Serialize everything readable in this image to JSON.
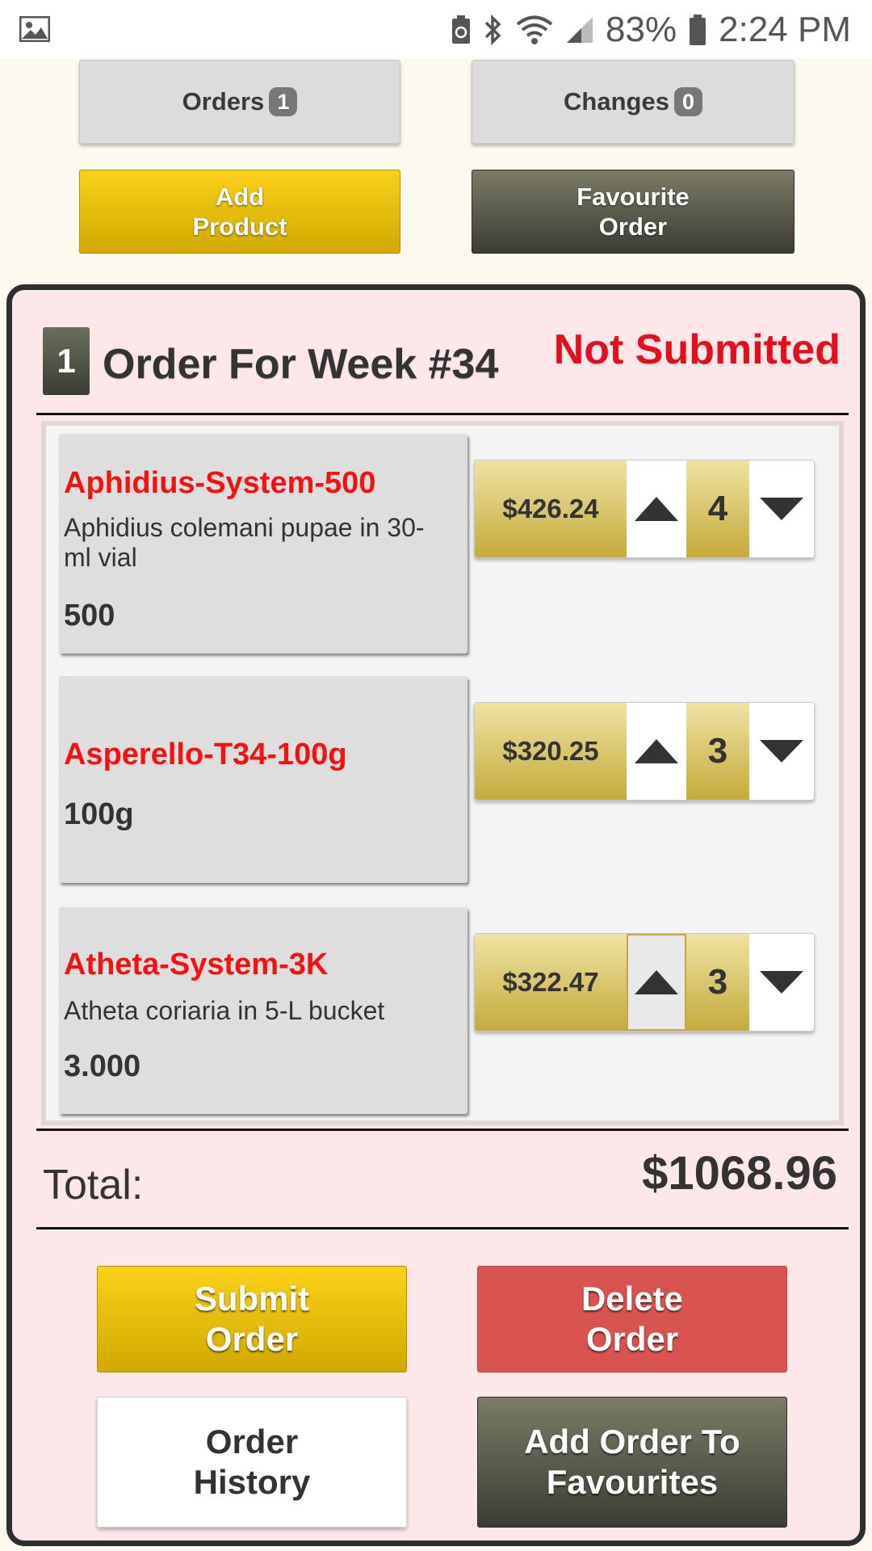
{
  "status_bar": {
    "battery_percent": "83%",
    "time": "2:24 PM"
  },
  "top_buttons": {
    "orders_label": "Orders",
    "orders_count": "1",
    "changes_label": "Changes",
    "changes_count": "0",
    "add_product_line1": "Add",
    "add_product_line2": "Product",
    "favourite_order_line1": "Favourite",
    "favourite_order_line2": "Order"
  },
  "order": {
    "number": "1",
    "title": "Order For Week #34",
    "status": "Not Submitted",
    "status_color": "#e40f1c",
    "items": [
      {
        "name": "Aphidius-System-500",
        "description": "Aphidius colemani pupae in 30-ml vial",
        "size": "500",
        "price": "$426.24",
        "quantity": "4"
      },
      {
        "name": "Asperello-T34-100g",
        "description": "",
        "size": "100g",
        "price": "$320.25",
        "quantity": "3"
      },
      {
        "name": "Atheta-System-3K",
        "description": "Atheta coriaria in 5-L bucket",
        "size": "3.000",
        "price": "$322.47",
        "quantity": "3"
      }
    ],
    "total_label": "Total:",
    "total_value": "$1068.96"
  },
  "actions": {
    "submit_line1": "Submit",
    "submit_line2": "Order",
    "delete_line1": "Delete",
    "delete_line2": "Order",
    "history_line1": "Order",
    "history_line2": "History",
    "add_fav_line1": "Add Order To",
    "add_fav_line2": "Favourites"
  },
  "colors": {
    "accent_yellow": "#fad119",
    "dark_olive": "#3c3c33",
    "danger_red": "#d9534f",
    "panel_pink": "#fde7e8",
    "product_name_red": "#f21212"
  },
  "icons": [
    "image-icon",
    "battery-saver-icon",
    "bluetooth-icon",
    "wifi-icon",
    "signal-icon",
    "battery-icon",
    "arrow-up-icon",
    "arrow-down-icon"
  ]
}
